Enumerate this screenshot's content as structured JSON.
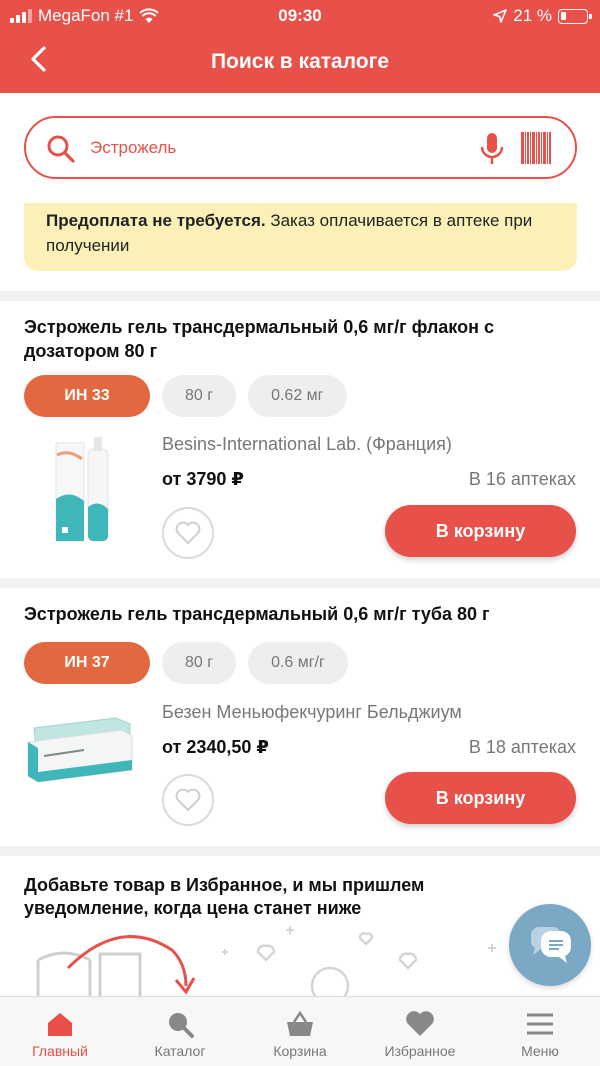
{
  "status": {
    "carrier": "MegaFon #1",
    "time": "09:30",
    "battery": "21 %"
  },
  "header": {
    "title": "Поиск в каталоге"
  },
  "search": {
    "value": "Эстрожель"
  },
  "notice": {
    "bold": "Предоплата не требуется.",
    "text": " Заказ оплачивается в аптеке при получении"
  },
  "products": [
    {
      "name": "Эстрожель гель трансдермальный 0,6 мг/г флакон с дозатором 80 г",
      "chips": [
        "ИН 33",
        "80 г",
        "0.62 мг"
      ],
      "maker": "Besins-International Lab. (Франция)",
      "price": "от 3790 ₽",
      "stores": "В 16 аптеках",
      "cart_label": "В корзину"
    },
    {
      "name": "Эстрожель гель трансдермальный 0,6 мг/г туба 80 г",
      "chips": [
        "ИН 37",
        "80 г",
        "0.6 мг/г"
      ],
      "maker": "Безен Меньюфекчуринг Бельджиум",
      "price": "от 2340,50 ₽",
      "stores": "В 18 аптеках",
      "cart_label": "В корзину"
    }
  ],
  "promo": {
    "text": "Добавьте товар в Избранное, и мы пришлем уведомление, когда цена станет ниже"
  },
  "tabs": [
    {
      "label": "Главный",
      "icon": "home-icon"
    },
    {
      "label": "Каталог",
      "icon": "catalog-search-icon"
    },
    {
      "label": "Корзина",
      "icon": "basket-icon"
    },
    {
      "label": "Избранное",
      "icon": "heart-icon"
    },
    {
      "label": "Меню",
      "icon": "menu-icon"
    }
  ],
  "colors": {
    "accent": "#e8504a",
    "chip_primary": "#e2693f",
    "notice_bg": "#fcf0b9",
    "chat": "#7ba8c4"
  }
}
